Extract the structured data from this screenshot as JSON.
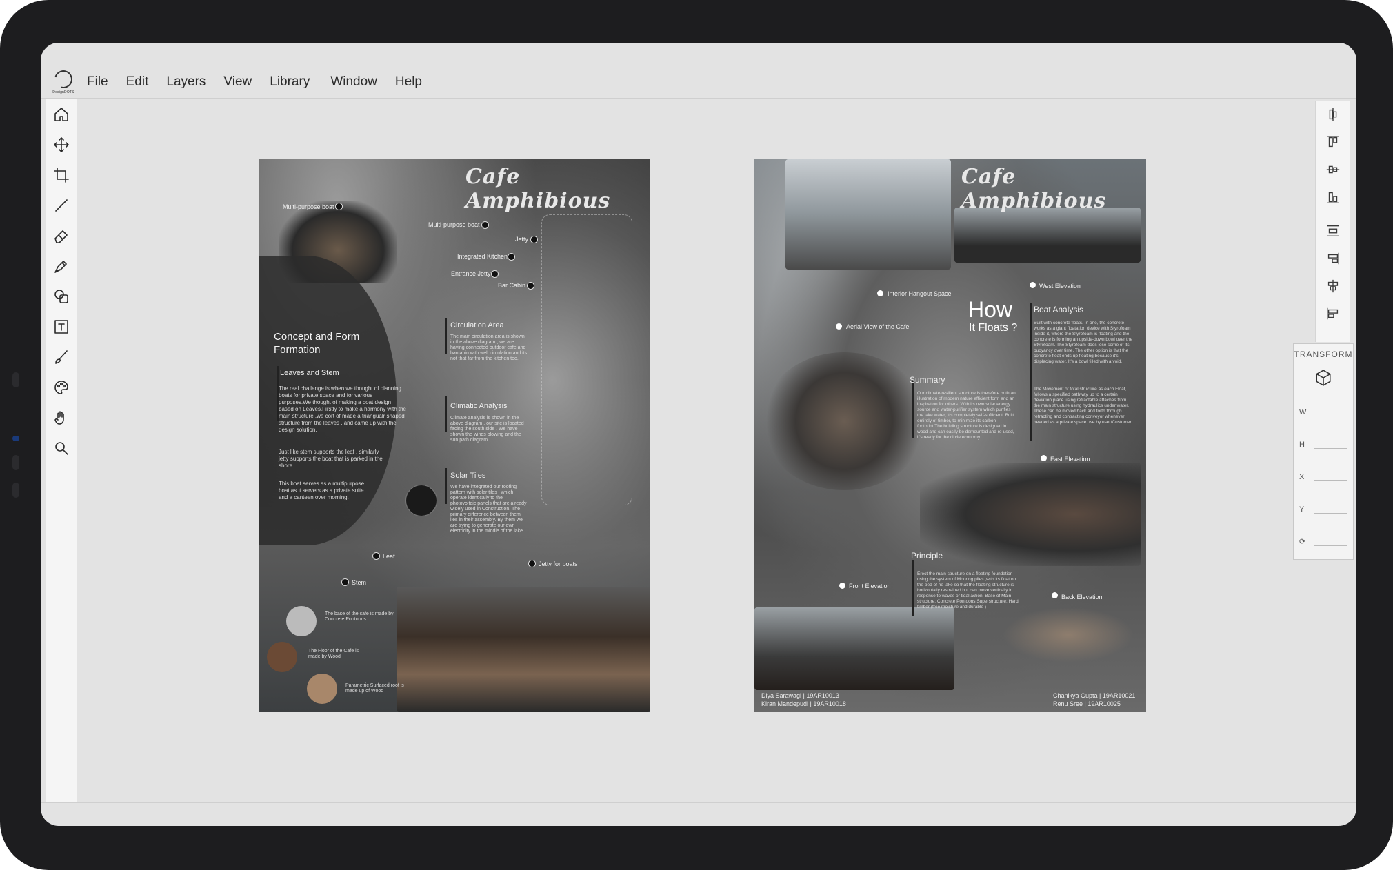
{
  "menu": [
    "File",
    "Edit",
    "Layers",
    "View",
    "Library",
    "Window",
    "Help"
  ],
  "logo_text": "DesignDOTS",
  "tools": [
    "home-icon",
    "move-icon",
    "crop-icon",
    "line-icon",
    "eraser-icon",
    "pen-icon",
    "shapes-icon",
    "text-icon",
    "brush-icon",
    "color-palette-icon",
    "hand-icon",
    "zoom-icon"
  ],
  "align_tools": [
    "align-vertical-center-icon",
    "align-top-icon",
    "align-middle-icon",
    "align-bottom-icon",
    "distribute-horizontal-icon",
    "align-right-icon",
    "align-center-icon",
    "align-left-icon"
  ],
  "transform": {
    "title": "TRANSFORM",
    "fields": [
      "W",
      "H",
      "X",
      "Y"
    ]
  },
  "poster1": {
    "title": "Cafe Amphibious",
    "labels": {
      "multi_boat_left": "Multi-purpose boat",
      "multi_boat": "Multi-purpose boat",
      "jetty": "Jetty",
      "kitchen": "Integrated Kitchen",
      "entrance": "Entrance Jetty",
      "bar_cabin": "Bar Cabin",
      "leaf": "Leaf",
      "stem": "Stem",
      "jetty_boats": "Jetty for boats"
    },
    "concept_title": "Concept and Form Formation",
    "leaves_title": "Leaves and Stem",
    "concept_p1": "The real challenge is when we thought of planning boats for private space and for various purposes.We thought of making a boat design based on Leaves.Firstly to make a harmony with the main structure ,we cort of made a triangualr shaped structure from the leaves , and came up with the design solution.",
    "concept_p2": "Just like stem supports the leaf , similarly jetty supports the boat that is parked in the shore.",
    "concept_p3": "This boat serves as a multipurpose boat as it servers as a private suite and a canteen over morning.",
    "circulation_title": "Circulation Area",
    "circulation_body": "The main circulation area is shown in the above diagram , we are having connected outdoor cafe and barcabin with well circulation and its not that far from the kitchen too.",
    "climatic_title": "Climatic Analysis",
    "climatic_body": "Climate analysis is shown in the above diagram , our site is located facing the south side . We have shown the winds blowing and the sun path diagram .",
    "solar_title": "Solar Tiles",
    "solar_body": "We have integrated our roofing pattern with solar tiles , which operate identically to the photovoltaic panels that are already widely used in Construction. The primary difference between them lies in their assembly. By them we are trying to generate our own electricity in the middle of the lake.",
    "material1": "The base of the cafe is made by Concrete Pontoons",
    "material2": "The Floor of the Cafe is made by Wood",
    "material3": "Parametric Surfaced roof is made up of Wood"
  },
  "poster2": {
    "title": "Cafe Amphibious",
    "labels": {
      "interior": "Interior Hangout Space",
      "west": "West Elevation",
      "aerial": "Aerial View of the Cafe",
      "east": "East Elevation",
      "front": "Front Elevation",
      "back": "Back Elevation"
    },
    "how": "How",
    "floats": "It Floats ?",
    "boat_title": "Boat Analysis",
    "boat_body1": "Built with concrete floats. In one, the concrete works as a giant floatation device with Styrofoam inside it, where the Styrofoam is floating and the concrete is forming an upside-down bowl over the Styrofoam. The Styrofoam does lose some of its buoyancy over time. The other option is that the concrete float ends up floating because it's displacing water. It's a bowl filled with a void.",
    "boat_body2": "The Movement of total structure as each Float, follows a specified pathway up to a certain deviation place using retractable attaches from the main structure using hydraulics under water. These can be moved back and forth through retracting and contracting conveyor whenever needed as a private space use by user/Customer.",
    "summary_title": "Summary",
    "summary_body": "Our climate-resilient structure is therefore both an illustration of modern nature efficient form and an inspiration for others. With its own solar energy source and water-purifier system which purifies the lake water, it's completely self-sufficient. Built entirely of timber, to minimize its carbon footprint.The building structure is designed in wood and can easily be demounted and re-used, it's ready for the circle economy.",
    "principle_title": "Principle",
    "principle_body": "Erect the main structure on a floating foundation using the system of Mooring piles ,with its float on the bed of he lake so that the floating structure is horizontally restrained but can move vertically in response to waves or tidal action. Base of Main structure: Concrete Pontoons Superstructure: Hard timber (free moisture and durable )",
    "credits_left": [
      "Diya Sarawagi  |  19AR10013",
      "Kiran Mandepudi  |  19AR10018"
    ],
    "credits_right": [
      "Chanikya Gupta  |  19AR10021",
      "Renu Sree  |  19AR10025"
    ]
  }
}
